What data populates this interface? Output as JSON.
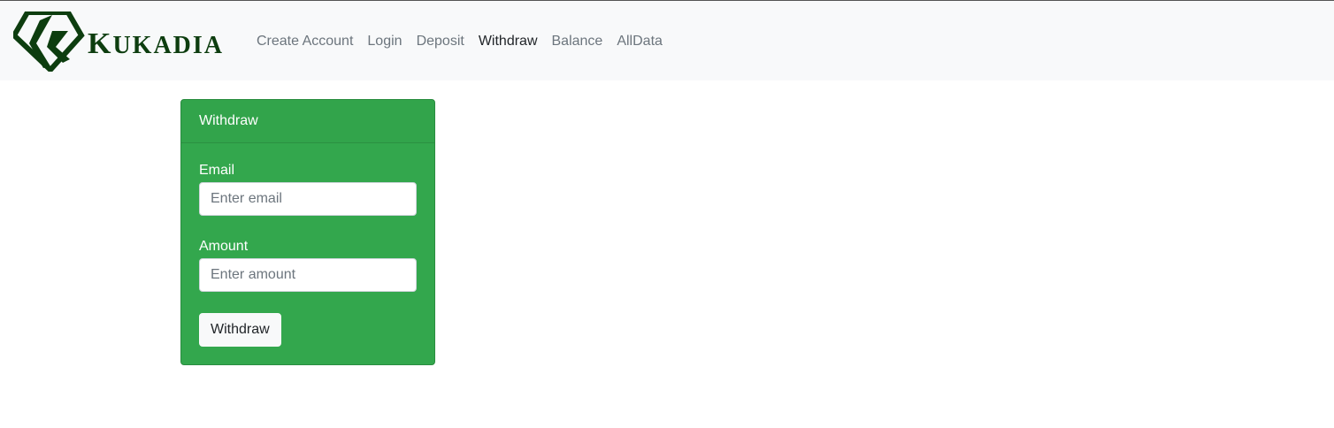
{
  "brand": {
    "name": "Kukadia",
    "logo_icon": "diamond-k-logo-icon",
    "logo_color": "#0d3d0f"
  },
  "nav": {
    "items": [
      {
        "label": "Create Account",
        "active": false
      },
      {
        "label": "Login",
        "active": false
      },
      {
        "label": "Deposit",
        "active": false
      },
      {
        "label": "Withdraw",
        "active": true
      },
      {
        "label": "Balance",
        "active": false
      },
      {
        "label": "AllData",
        "active": false
      }
    ]
  },
  "card": {
    "header": "Withdraw",
    "background_color": "#33a74d",
    "email": {
      "label": "Email",
      "placeholder": "Enter email",
      "value": ""
    },
    "amount": {
      "label": "Amount",
      "placeholder": "Enter amount",
      "value": ""
    },
    "submit_label": "Withdraw"
  }
}
